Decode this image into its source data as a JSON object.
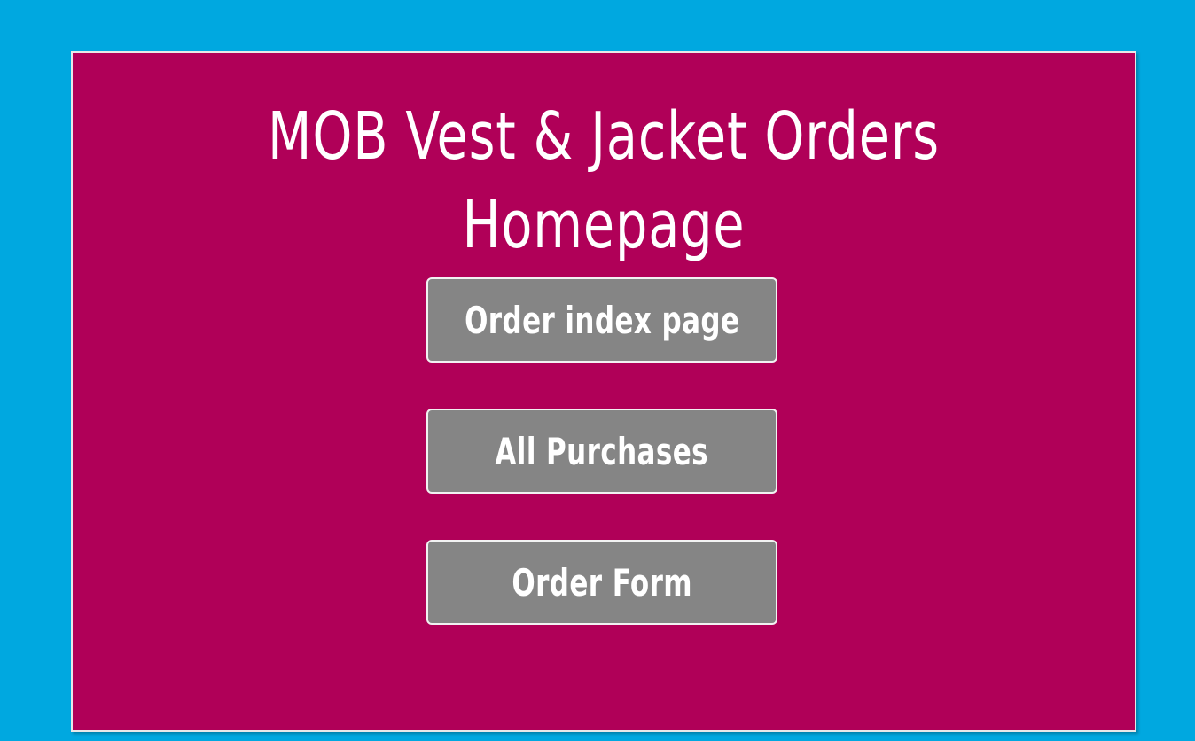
{
  "page": {
    "background_color": "#00A8E0",
    "panel_color": "#B00058",
    "button_color": "#858585"
  },
  "header": {
    "title_line1": "MOB Vest & Jacket Orders",
    "title_line2": "Homepage"
  },
  "nav": {
    "buttons": [
      {
        "label": "Order index page"
      },
      {
        "label": "All Purchases"
      },
      {
        "label": "Order Form"
      }
    ]
  }
}
